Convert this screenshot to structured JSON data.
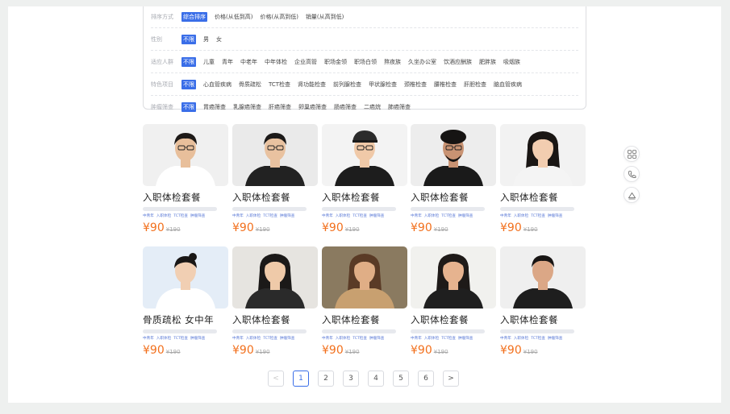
{
  "filters": {
    "sort": {
      "label": "排序方式",
      "options": [
        "综合排序",
        "价格(从低到高)",
        "价格(从高到低)",
        "销量(从高到低)"
      ]
    },
    "gender": {
      "label": "性别",
      "options": [
        "不限",
        "男",
        "女"
      ]
    },
    "crowd": {
      "label": "适应人群",
      "options": [
        "不限",
        "儿童",
        "青年",
        "中老年",
        "中年体检",
        "企业高管",
        "职场金领",
        "职场白领",
        "熬夜族",
        "久坐办公室",
        "饮酒应酬族",
        "肥胖族",
        "吸烟族"
      ]
    },
    "feature": {
      "label": "特色项目",
      "options": [
        "不限",
        "心血管疾病",
        "骨质疏松",
        "TCT检查",
        "肾功能检查",
        "前列腺检查",
        "甲状腺检查",
        "颈椎检查",
        "腰椎检查",
        "肝胆检查",
        "脑血管疾病"
      ]
    },
    "tumor": {
      "label": "肿瘤筛查",
      "options": [
        "不限",
        "胃癌筛查",
        "乳腺癌筛查",
        "肝癌筛查",
        "卵巢癌筛查",
        "肠癌筛查",
        "二癌烷",
        "肺癌筛查"
      ]
    }
  },
  "products": [
    {
      "title": "入职体检套餐",
      "tags": [
        "中青年",
        "入职体检",
        "TCT检查",
        "肿瘤筛查"
      ],
      "price": "¥90",
      "old_price": "¥190"
    },
    {
      "title": "入职体检套餐",
      "tags": [
        "中青年",
        "入职体检",
        "TCT检查",
        "肿瘤筛查"
      ],
      "price": "¥90",
      "old_price": "¥190"
    },
    {
      "title": "入职体检套餐",
      "tags": [
        "中青年",
        "入职体检",
        "TCT检查",
        "肿瘤筛查"
      ],
      "price": "¥90",
      "old_price": "¥190"
    },
    {
      "title": "入职体检套餐",
      "tags": [
        "中青年",
        "入职体检",
        "TCT检查",
        "肿瘤筛查"
      ],
      "price": "¥90",
      "old_price": "¥190"
    },
    {
      "title": "入职体检套餐",
      "tags": [
        "中青年",
        "入职体检",
        "TCT检查",
        "肿瘤筛查"
      ],
      "price": "¥90",
      "old_price": "¥190"
    },
    {
      "title": "骨质疏松 女中年",
      "tags": [
        "中青年",
        "入职体检",
        "TCT检查",
        "肿瘤筛查"
      ],
      "price": "¥90",
      "old_price": "¥190"
    },
    {
      "title": "入职体检套餐",
      "tags": [
        "中青年",
        "入职体检",
        "TCT检查",
        "肿瘤筛查"
      ],
      "price": "¥90",
      "old_price": "¥190"
    },
    {
      "title": "入职体检套餐",
      "tags": [
        "中青年",
        "入职体检",
        "TCT检查",
        "肿瘤筛查"
      ],
      "price": "¥90",
      "old_price": "¥190"
    },
    {
      "title": "入职体检套餐",
      "tags": [
        "中青年",
        "入职体检",
        "TCT检查",
        "肿瘤筛查"
      ],
      "price": "¥90",
      "old_price": "¥190"
    },
    {
      "title": "入职体检套餐",
      "tags": [
        "中青年",
        "入职体检",
        "TCT检查",
        "肿瘤筛查"
      ],
      "price": "¥90",
      "old_price": "¥190"
    }
  ],
  "pagination": {
    "prev": "<",
    "next": ">",
    "pages": [
      "1",
      "2",
      "3",
      "4",
      "5",
      "6"
    ],
    "current": "1"
  },
  "sidebar": {
    "icons": [
      "grid-icon",
      "phone-icon",
      "back-to-top-icon"
    ]
  },
  "colors": {
    "accent": "#3a6ee8",
    "price": "#f2701d",
    "tag": "#5a79d6"
  }
}
